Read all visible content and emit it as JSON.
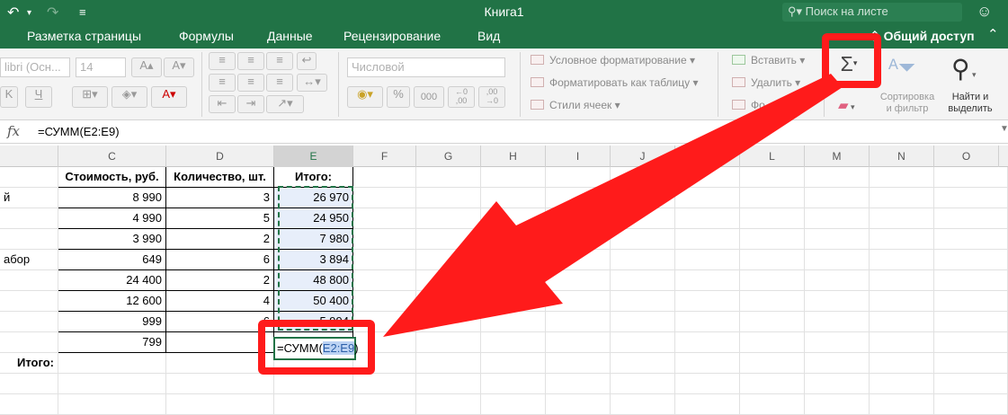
{
  "title_bar": {
    "title": "Книга1",
    "search_placeholder": "Поиск на листе",
    "undo_icon": "undo-icon",
    "redo_icon": "redo-icon",
    "customize_icon": "customize-icon"
  },
  "ribbon_tabs": [
    "Разметка страницы",
    "Формулы",
    "Данные",
    "Рецензирование",
    "Вид"
  ],
  "share_label": "Общий доступ",
  "ribbon": {
    "font_name": "libri (Осн...",
    "font_size": "14",
    "number_format": "Числовой",
    "conditional_formatting": "Условное форматирование",
    "format_as_table": "Форматировать как таблицу",
    "cell_styles": "Стили ячеек",
    "insert": "Вставить",
    "delete": "Удалить",
    "format": "Фо",
    "autosum_symbol": "Σ",
    "sort_filter": [
      "Сортировка",
      "и фильтр"
    ],
    "find_select": [
      "Найти и",
      "выделить"
    ]
  },
  "formula_bar": {
    "fx_label": "fx",
    "formula": "=СУММ(E2:E9)"
  },
  "columns": [
    "C",
    "D",
    "E",
    "F",
    "G",
    "H",
    "I",
    "J",
    "K",
    "L",
    "M",
    "N",
    "O"
  ],
  "table": {
    "headers": {
      "c": "Стоимость, руб.",
      "d": "Количество, шт.",
      "e": "Итого:"
    },
    "rows": [
      {
        "b": "й",
        "c": "8 990",
        "d": "3",
        "e": "26 970"
      },
      {
        "b": "",
        "c": "4 990",
        "d": "5",
        "e": "24 950"
      },
      {
        "b": "",
        "c": "3 990",
        "d": "2",
        "e": "7 980"
      },
      {
        "b": "абор",
        "c": "649",
        "d": "6",
        "e": "3 894"
      },
      {
        "b": "",
        "c": "24 400",
        "d": "2",
        "e": "48 800"
      },
      {
        "b": "",
        "c": "12 600",
        "d": "4",
        "e": "50 400"
      },
      {
        "b": "",
        "c": "999",
        "d": "6",
        "e": "5 994"
      },
      {
        "b": "",
        "c": "799",
        "d": "",
        "e": ""
      }
    ],
    "total_label": "Итого:",
    "active_formula_prefix": "=СУММ(",
    "active_formula_ref": "E2:E9",
    "active_formula_suffix": ")"
  },
  "colors": {
    "excel_green": "#217346",
    "annotation_red": "#ff1b1b",
    "selection_blue": "#e7eefa"
  }
}
